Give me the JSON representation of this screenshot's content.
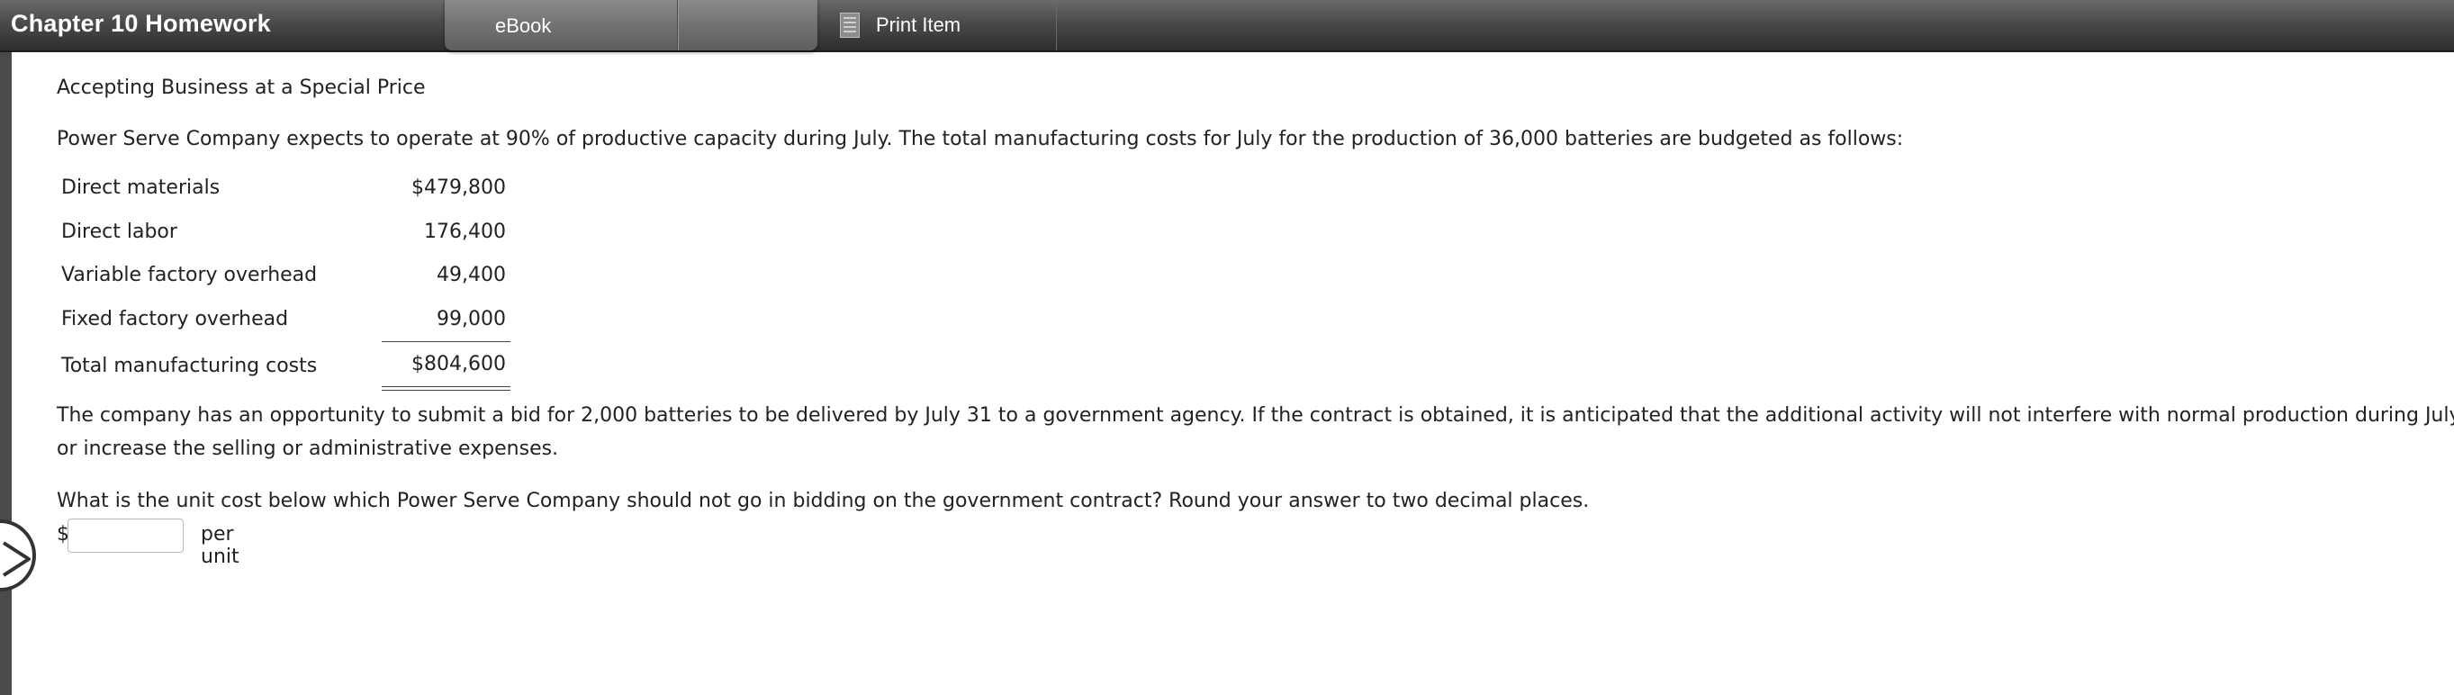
{
  "header": {
    "title": "Chapter 10 Homework",
    "tabs": [
      "eBook",
      ""
    ],
    "print_label": "Print Item"
  },
  "problem": {
    "heading": "Accepting Business at a Special Price",
    "intro": "Power Serve Company expects to operate at 90% of productive capacity during July. The total manufacturing costs for July for the production of 36,000 batteries are budgeted as follows:",
    "costs": [
      {
        "label": "Direct materials",
        "value": "$479,800"
      },
      {
        "label": "Direct labor",
        "value": "176,400"
      },
      {
        "label": "Variable factory overhead",
        "value": "49,400"
      },
      {
        "label": "Fixed factory overhead",
        "value": "99,000"
      },
      {
        "label": "Total manufacturing costs",
        "value": "$804,600"
      }
    ],
    "body_line1": "The company has an opportunity to submit a bid for 2,000 batteries to be delivered by July 31 to a government agency. If the contract is obtained, it is anticipated that the additional activity will not interfere with normal production during July",
    "body_line2": "or increase the selling or administrative expenses.",
    "question": "What is the unit cost below which Power Serve Company should not go in bidding on the government contract? Round your answer to two decimal places.",
    "answer": {
      "currency": "$",
      "value": "",
      "unit": "per unit"
    }
  },
  "icons": {
    "print": "document-print-icon",
    "nav": "chevron-right-icon"
  }
}
